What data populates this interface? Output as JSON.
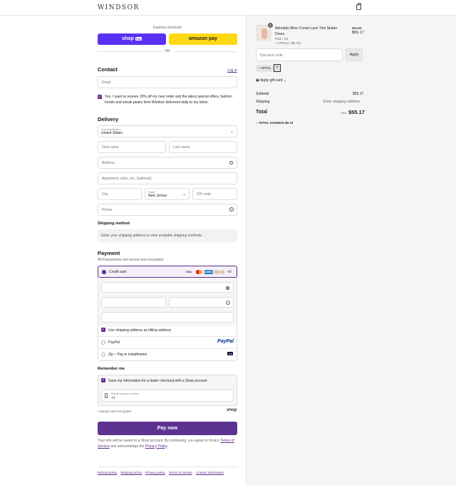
{
  "brand": {
    "logo": "WINDSOR",
    "accent": "#5e2e8e"
  },
  "express": {
    "title": "Express checkout",
    "shop_pay": "shop",
    "shop_pay_badge": "Pay",
    "amazon_pay": "amazon pay",
    "or": "OR"
  },
  "contact": {
    "heading": "Contact",
    "login": "Log in",
    "email_placeholder": "Email",
    "marketing_text": "Yes, I want to receive 15% off my next order and the latest special offers, fashion trends and sneak peaks from Windsor delivered daily to my inbox."
  },
  "delivery": {
    "heading": "Delivery",
    "country_label": "Country/Region",
    "country_value": "United States",
    "first_name": "First name",
    "last_name": "Last name",
    "address": "Address",
    "apartment": "Apartment, suite, etc. (optional)",
    "city": "City",
    "state_label": "State",
    "state_value": "New Jersey",
    "zip": "ZIP code",
    "phone": "Phone"
  },
  "shipping_method": {
    "heading": "Shipping method",
    "notice": "Enter your shipping address to view available shipping methods."
  },
  "payment": {
    "heading": "Payment",
    "subtitle": "All transactions are secure and encrypted.",
    "credit_card_label": "Credit card",
    "card_brands": [
      "VISA",
      "MC",
      "AMEX",
      "DISCOVER"
    ],
    "more_brands": "+3",
    "billing_same": "Use shipping address as billing address",
    "paypal_label": "PayPal",
    "paypal_logo": "PayPal",
    "zip_label": "Zip – Pay in installments",
    "zip_logo": "zip"
  },
  "remember": {
    "heading": "Remember me",
    "save_info": "Save my information for a faster checkout with a Shop account",
    "mobile_label": "Mobile phone number",
    "mobile_value": "+1",
    "secure": "Secure and encrypted",
    "shop": "shop"
  },
  "pay_now": "Pay now",
  "legal": {
    "text_before": "Your info will be saved to a Shop account. By continuing, you agree to Shop's",
    "terms": "Terms of Service",
    "and": "and acknowledge the",
    "privacy": "Privacy Policy",
    "period": "."
  },
  "footer_links": [
    "Refund policy",
    "Shipping policy",
    "Privacy policy",
    "Terms of service",
    "Contact information"
  ],
  "order": {
    "item": {
      "name_line1": "Adorably Mine Corset Lace Trim Skater",
      "name_line2": "Dress",
      "variant": "Pink / XS",
      "discount_tag": "APP15 (−$9.73)",
      "quantity": "1",
      "original_price": "$64.90",
      "price": "$55.17"
    },
    "discount_placeholder": "Discount code",
    "apply": "Apply",
    "applied_code": "APP15",
    "remove": "×",
    "gift_card": "Apply gift card",
    "subtotal_label": "Subtotal",
    "subtotal_value": "$55.17",
    "shipping_label": "Shipping",
    "shipping_value": "Enter shipping address",
    "total_label": "Total",
    "currency": "USD",
    "total_value": "$55.17",
    "savings_label": "TOTAL SAVINGS",
    "savings_value": "$9.73"
  }
}
